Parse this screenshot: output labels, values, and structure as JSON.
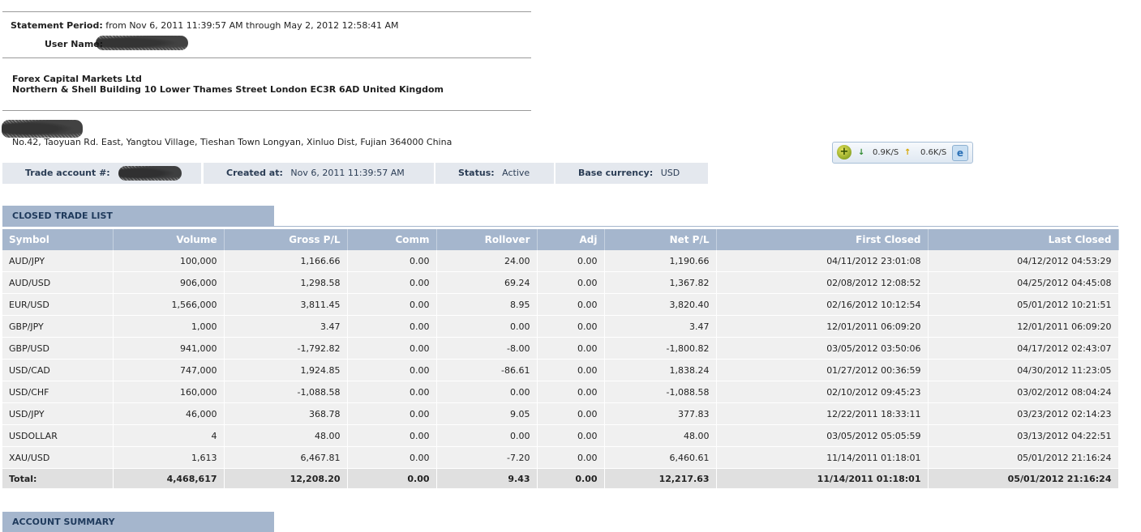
{
  "statement": {
    "period_label": "Statement Period:",
    "period_value": "from Nov 6, 2011 11:39:57 AM through May 2, 2012 12:58:41 AM",
    "user_label": "User Name:"
  },
  "broker": {
    "name": "Forex Capital Markets Ltd",
    "address": "Northern & Shell Building 10 Lower Thames Street London EC3R 6AD United Kingdom"
  },
  "client": {
    "address": "No.42, Taoyuan Rd. East, Yangtou Village, Tieshan Town Longyan, Xinluo Dist, Fujian 364000 China"
  },
  "account": {
    "trade_account_label": "Trade account #:",
    "created_label": "Created at:",
    "created_value": "Nov 6, 2011 11:39:57 AM",
    "status_label": "Status:",
    "status_value": "Active",
    "currency_label": "Base currency:",
    "currency_value": "USD"
  },
  "speed_widget": {
    "download": "0.9K/S",
    "upload": "0.6K/S",
    "icons": [
      "plus-circle-icon",
      "arrow-down-icon",
      "arrow-up-icon",
      "browser-icon"
    ]
  },
  "closed_trades": {
    "title": "CLOSED TRADE LIST",
    "columns": [
      "Symbol",
      "Volume",
      "Gross P/L",
      "Comm",
      "Rollover",
      "Adj",
      "Net P/L",
      "First Closed",
      "Last Closed"
    ],
    "rows": [
      [
        "AUD/JPY",
        "100,000",
        "1,166.66",
        "0.00",
        "24.00",
        "0.00",
        "1,190.66",
        "04/11/2012 23:01:08",
        "04/12/2012 04:53:29"
      ],
      [
        "AUD/USD",
        "906,000",
        "1,298.58",
        "0.00",
        "69.24",
        "0.00",
        "1,367.82",
        "02/08/2012 12:08:52",
        "04/25/2012 04:45:08"
      ],
      [
        "EUR/USD",
        "1,566,000",
        "3,811.45",
        "0.00",
        "8.95",
        "0.00",
        "3,820.40",
        "02/16/2012 10:12:54",
        "05/01/2012 10:21:51"
      ],
      [
        "GBP/JPY",
        "1,000",
        "3.47",
        "0.00",
        "0.00",
        "0.00",
        "3.47",
        "12/01/2011 06:09:20",
        "12/01/2011 06:09:20"
      ],
      [
        "GBP/USD",
        "941,000",
        "-1,792.82",
        "0.00",
        "-8.00",
        "0.00",
        "-1,800.82",
        "03/05/2012 03:50:06",
        "04/17/2012 02:43:07"
      ],
      [
        "USD/CAD",
        "747,000",
        "1,924.85",
        "0.00",
        "-86.61",
        "0.00",
        "1,838.24",
        "01/27/2012 00:36:59",
        "04/30/2012 11:23:05"
      ],
      [
        "USD/CHF",
        "160,000",
        "-1,088.58",
        "0.00",
        "0.00",
        "0.00",
        "-1,088.58",
        "02/10/2012 09:45:23",
        "03/02/2012 08:04:24"
      ],
      [
        "USD/JPY",
        "46,000",
        "368.78",
        "0.00",
        "9.05",
        "0.00",
        "377.83",
        "12/22/2011 18:33:11",
        "03/23/2012 02:14:23"
      ],
      [
        "USDOLLAR",
        "4",
        "48.00",
        "0.00",
        "0.00",
        "0.00",
        "48.00",
        "03/05/2012 05:05:59",
        "03/13/2012 04:22:51"
      ],
      [
        "XAU/USD",
        "1,613",
        "6,467.81",
        "0.00",
        "-7.20",
        "0.00",
        "6,460.61",
        "11/14/2011 01:18:01",
        "05/01/2012 21:16:24"
      ]
    ],
    "total": [
      "Total:",
      "4,468,617",
      "12,208.20",
      "0.00",
      "9.43",
      "0.00",
      "12,217.63",
      "11/14/2011 01:18:01",
      "05/01/2012 21:16:24"
    ]
  },
  "account_summary": {
    "title": "ACCOUNT SUMMARY"
  }
}
